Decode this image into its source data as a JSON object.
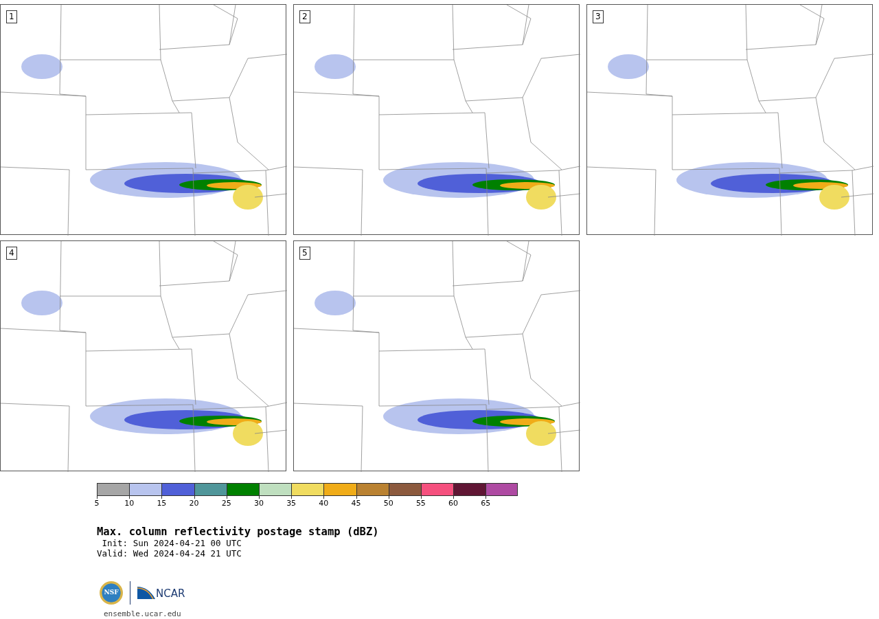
{
  "panels": [
    {
      "label": "1"
    },
    {
      "label": "2"
    },
    {
      "label": "3"
    },
    {
      "label": "4"
    },
    {
      "label": "5"
    }
  ],
  "colorbar": {
    "segments": [
      {
        "color": "#a6a6a6",
        "tick": "5"
      },
      {
        "color": "#b8c4ee",
        "tick": "10"
      },
      {
        "color": "#5060d8",
        "tick": "15"
      },
      {
        "color": "#50969a",
        "tick": "20"
      },
      {
        "color": "#008000",
        "tick": "25"
      },
      {
        "color": "#bfdfbf",
        "tick": "30"
      },
      {
        "color": "#f0dc60",
        "tick": "35"
      },
      {
        "color": "#f0ac18",
        "tick": "40"
      },
      {
        "color": "#ba8232",
        "tick": "45"
      },
      {
        "color": "#8c5a3e",
        "tick": "50"
      },
      {
        "color": "#f5507e",
        "tick": "55"
      },
      {
        "color": "#601634",
        "tick": "60"
      },
      {
        "color": "#ae4aa2",
        "tick": "65"
      }
    ]
  },
  "title": "Max. column reflectivity postage stamp (dBZ)",
  "init": "Init: Sun 2024-04-21 00 UTC",
  "valid": "Valid: Wed 2024-04-24 21 UTC",
  "logos": {
    "nsf": "NSF",
    "ncar": "NCAR"
  },
  "footer": "ensemble.ucar.edu"
}
